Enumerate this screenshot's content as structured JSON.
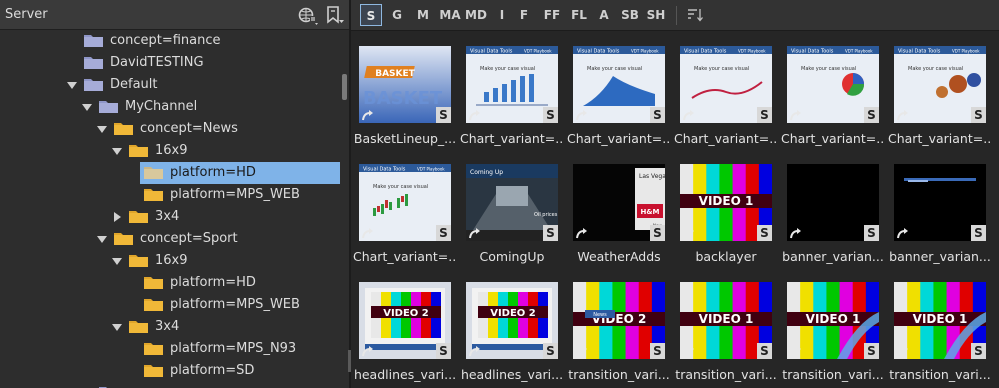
{
  "left_panel": {
    "title": "Server",
    "tree": [
      {
        "label": "concept=finance",
        "icon": "folder-blue-icon"
      },
      {
        "label": "DavidTESTING",
        "icon": "folder-blue-icon"
      },
      {
        "label": "Default",
        "icon": "folder-blue-icon",
        "expanded": true
      },
      {
        "label": "MyChannel",
        "icon": "folder-blue-icon",
        "expanded": true
      },
      {
        "label": "concept=News",
        "icon": "folder-yellow-icon",
        "expanded": true
      },
      {
        "label": "16x9",
        "icon": "folder-yellow-icon",
        "expanded": true
      },
      {
        "label": "platform=HD",
        "icon": "folder-yellow-icon",
        "selected": true
      },
      {
        "label": "platform=MPS_WEB",
        "icon": "folder-yellow-icon"
      },
      {
        "label": "3x4",
        "icon": "folder-yellow-icon",
        "expanded": false
      },
      {
        "label": "concept=Sport",
        "icon": "folder-yellow-icon",
        "expanded": true
      },
      {
        "label": "16x9",
        "icon": "folder-yellow-icon",
        "expanded": true
      },
      {
        "label": "platform=HD",
        "icon": "folder-yellow-icon"
      },
      {
        "label": "platform=MPS_WEB",
        "icon": "folder-yellow-icon"
      },
      {
        "label": "3x4",
        "icon": "folder-yellow-icon",
        "expanded": true
      },
      {
        "label": "platform=MPS_N93",
        "icon": "folder-yellow-icon"
      },
      {
        "label": "platform=SD",
        "icon": "folder-yellow-icon"
      }
    ]
  },
  "filter_bar": {
    "buttons": [
      "S",
      "G",
      "M",
      "MA",
      "MD",
      "I",
      "F",
      "FF",
      "FL",
      "A",
      "SB",
      "SH"
    ],
    "active": "S"
  },
  "scenes": [
    {
      "label": "BasketLineup_...",
      "thumb": "basket"
    },
    {
      "label": "Chart_variant=...",
      "thumb": "chart-bars"
    },
    {
      "label": "Chart_variant=...",
      "thumb": "chart-area"
    },
    {
      "label": "Chart_variant=...",
      "thumb": "chart-line"
    },
    {
      "label": "Chart_variant=...",
      "thumb": "chart-pie"
    },
    {
      "label": "Chart_variant=...",
      "thumb": "chart-spheres"
    },
    {
      "label": "Chart_variant=...",
      "thumb": "chart-candle"
    },
    {
      "label": "ComingUp",
      "thumb": "comingup"
    },
    {
      "label": "WeatherAdds",
      "thumb": "weather"
    },
    {
      "label": "backlayer",
      "thumb": "colorbars"
    },
    {
      "label": "banner_varian...",
      "thumb": "black"
    },
    {
      "label": "banner_varian...",
      "thumb": "black-bar"
    },
    {
      "label": "headlines_vari...",
      "thumb": "headlines"
    },
    {
      "label": "headlines_vari...",
      "thumb": "headlines"
    },
    {
      "label": "transition_vari...",
      "thumb": "colorbars-news"
    },
    {
      "label": "transition_vari...",
      "thumb": "colorbars"
    },
    {
      "label": "transition_vari...",
      "thumb": "colorbars-swoosh"
    },
    {
      "label": "transition_vari...",
      "thumb": "colorbars-swoosh"
    }
  ],
  "thumb_text": {
    "basket_logo": "BASKET",
    "chart_header": "Visual Data Tools",
    "chart_header_right": "VDT Playbook",
    "chart_caption": "Make your case visual",
    "coming_up": "Coming Up",
    "oil_prices": "Oil prices",
    "weather_title": "Las Vegas",
    "weather_brand": "H&M",
    "weather_footer": "New",
    "video_1": "VIDEO 1",
    "video_2": "VIDEO 2",
    "news_tag": "News"
  },
  "badge_letter": "S",
  "colors": {
    "selected_row": "#7fb3e8",
    "folder_blue": "#8f96c8",
    "folder_yellow": "#f0b838",
    "active_filter_border": "#8fb8e0"
  }
}
